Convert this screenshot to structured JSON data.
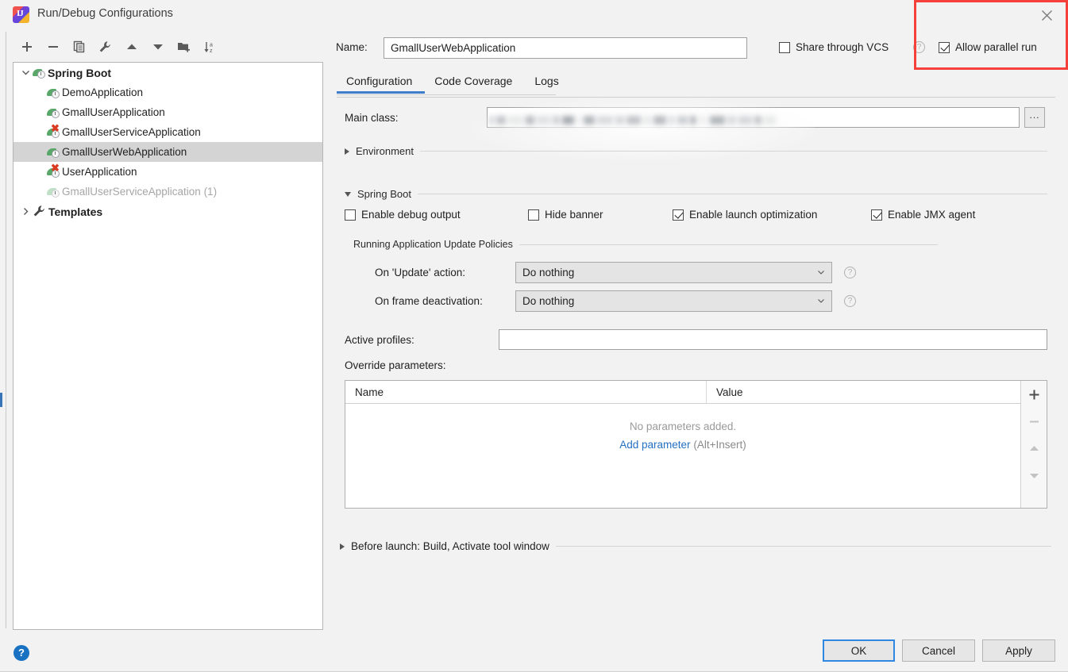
{
  "window": {
    "title": "Run/Debug Configurations",
    "app_icon": "intellij-idea-icon",
    "close_icon": "close-icon"
  },
  "annotation": {
    "highlight_color": "#f5403c",
    "target": "allow-parallel-run-checkbox"
  },
  "toolbar": {
    "buttons": [
      {
        "name": "add-configuration-button",
        "icon": "plus-icon"
      },
      {
        "name": "remove-configuration-button",
        "icon": "minus-icon"
      },
      {
        "name": "copy-configuration-button",
        "icon": "copy-icon"
      },
      {
        "name": "edit-templates-button",
        "icon": "wrench-icon"
      },
      {
        "name": "move-up-button",
        "icon": "arrow-up-icon"
      },
      {
        "name": "move-down-button",
        "icon": "arrow-down-icon"
      },
      {
        "name": "new-folder-button",
        "icon": "new-folder-icon"
      },
      {
        "name": "sort-configurations-button",
        "icon": "sort-az-icon"
      }
    ]
  },
  "tree": {
    "nodes": [
      {
        "label": "Spring Boot",
        "icon": "spring-boot-icon",
        "level": 0,
        "expanded": true,
        "bold": true,
        "selected": false,
        "dim": false,
        "error": false
      },
      {
        "label": "DemoApplication",
        "icon": "spring-boot-icon",
        "level": 1,
        "bold": false,
        "selected": false,
        "dim": false,
        "error": false
      },
      {
        "label": "GmallUserApplication",
        "icon": "spring-boot-icon",
        "level": 1,
        "bold": false,
        "selected": false,
        "dim": false,
        "error": false
      },
      {
        "label": "GmallUserServiceApplication",
        "icon": "spring-boot-error-icon",
        "level": 1,
        "bold": false,
        "selected": false,
        "dim": false,
        "error": true
      },
      {
        "label": "GmallUserWebApplication",
        "icon": "spring-boot-icon",
        "level": 1,
        "bold": false,
        "selected": true,
        "dim": false,
        "error": false
      },
      {
        "label": "UserApplication",
        "icon": "spring-boot-error-icon",
        "level": 1,
        "bold": false,
        "selected": false,
        "dim": false,
        "error": true
      },
      {
        "label": "GmallUserServiceApplication (1)",
        "icon": "spring-boot-icon",
        "level": 1,
        "bold": false,
        "selected": false,
        "dim": true,
        "error": false
      },
      {
        "label": "Templates",
        "icon": "wrench-icon",
        "level": 0,
        "expanded": false,
        "bold": true,
        "selected": false,
        "dim": false,
        "error": false
      }
    ]
  },
  "header": {
    "name_label": "Name:",
    "name_value": "GmallUserWebApplication",
    "share_vcs_label": "Share through VCS",
    "share_vcs_checked": false,
    "share_vcs_help_icon": "question-icon",
    "allow_parallel_label": "Allow parallel run",
    "allow_parallel_checked": true
  },
  "tabs": [
    {
      "label": "Configuration",
      "active": true
    },
    {
      "label": "Code Coverage",
      "active": false
    },
    {
      "label": "Logs",
      "active": false
    }
  ],
  "configuration": {
    "main_class_label": "Main class:",
    "main_class_value": "",
    "main_class_redacted": true,
    "browse_button_label": "...",
    "environment_group": "Environment",
    "environment_expanded": false,
    "spring_boot_group": "Spring Boot",
    "spring_boot_expanded": true,
    "checkboxes": [
      {
        "label": "Enable debug output",
        "checked": false
      },
      {
        "label": "Hide banner",
        "checked": false
      },
      {
        "label": "Enable launch optimization",
        "checked": true
      },
      {
        "label": "Enable JMX agent",
        "checked": true
      }
    ],
    "update_policies_group": "Running Application Update Policies",
    "update_action_label": "On 'Update' action:",
    "update_action_value": "Do nothing",
    "frame_deactivation_label": "On frame deactivation:",
    "frame_deactivation_value": "Do nothing",
    "active_profiles_label": "Active profiles:",
    "active_profiles_value": "",
    "override_parameters_label": "Override parameters:",
    "table": {
      "columns": [
        "Name",
        "Value"
      ],
      "rows": [],
      "empty_text": "No parameters added.",
      "add_link": "Add parameter",
      "add_hint": "(Alt+Insert)",
      "side_buttons": [
        {
          "name": "add-parameter-button",
          "icon": "plus-icon",
          "enabled": true
        },
        {
          "name": "remove-parameter-button",
          "icon": "minus-icon",
          "enabled": false
        },
        {
          "name": "move-parameter-up-button",
          "icon": "arrow-up-icon",
          "enabled": false
        },
        {
          "name": "move-parameter-down-button",
          "icon": "arrow-down-icon",
          "enabled": false
        }
      ]
    },
    "before_launch": "Before launch: Build, Activate tool window",
    "before_launch_expanded": false
  },
  "footer": {
    "help_icon": "help-icon",
    "buttons": [
      {
        "label": "OK",
        "default": true
      },
      {
        "label": "Cancel",
        "default": false
      },
      {
        "label": "Apply",
        "default": false
      }
    ]
  }
}
